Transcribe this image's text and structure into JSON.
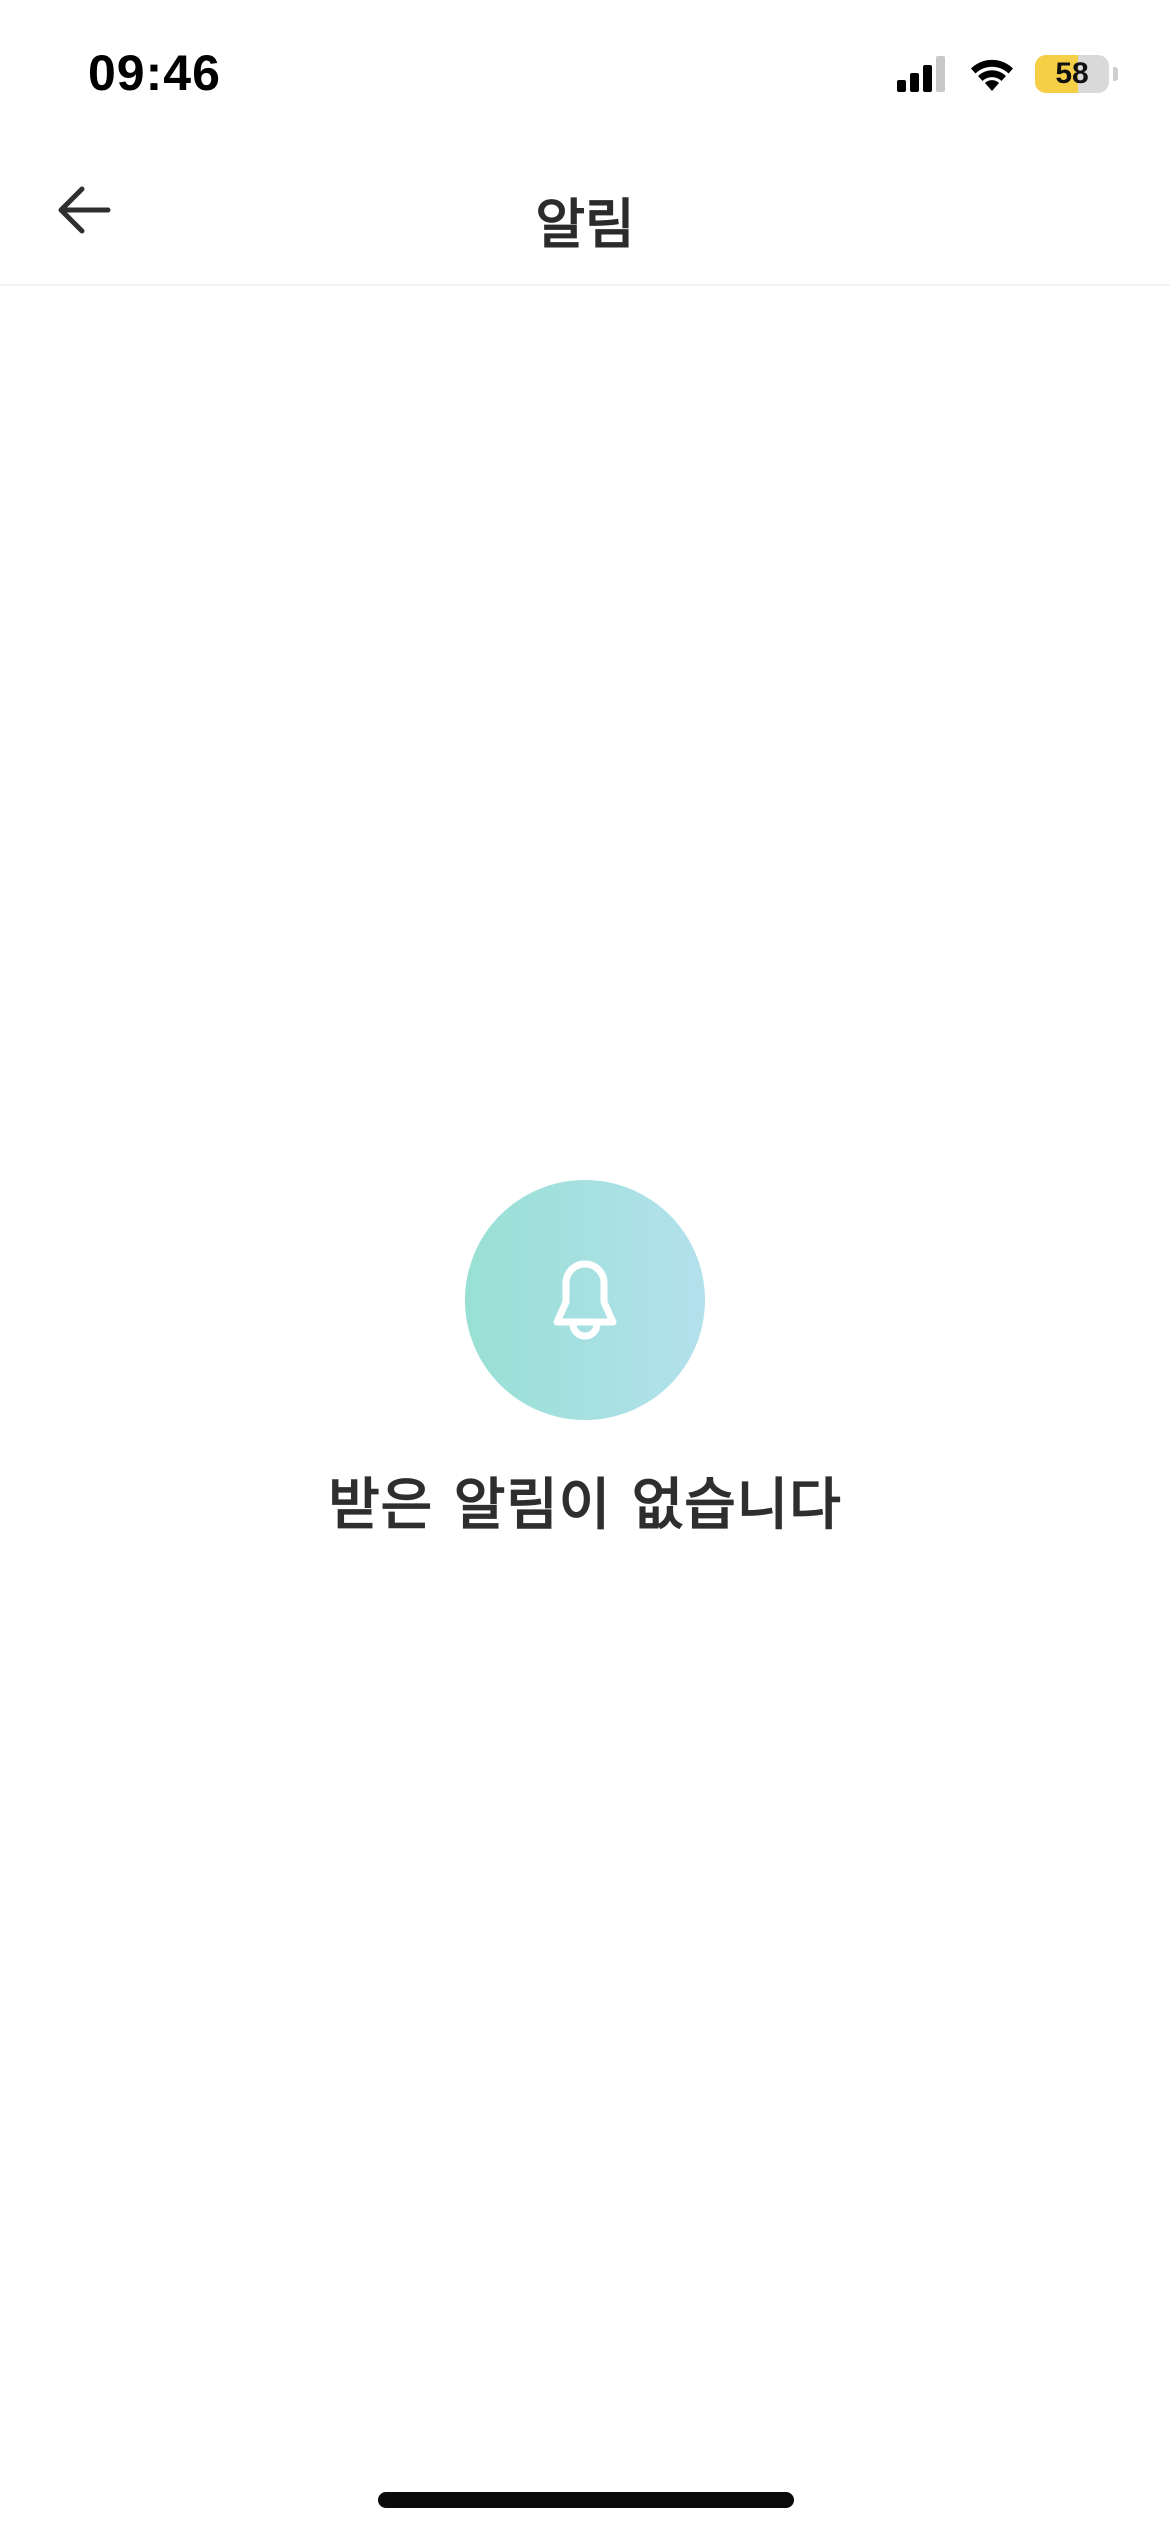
{
  "status_bar": {
    "time": "09:46",
    "battery_level": "58",
    "battery_fraction": 0.58,
    "battery_color": "#f5cf45",
    "icons": [
      "cellular-signal-icon",
      "wifi-icon",
      "battery-icon"
    ]
  },
  "header": {
    "title": "알림",
    "back_icon": "arrow-left-icon"
  },
  "empty_state": {
    "icon": "bell-icon",
    "message": "받은 알림이 없습니다",
    "circle_gradient": [
      "#98e0d4",
      "#b3e1ed"
    ]
  }
}
